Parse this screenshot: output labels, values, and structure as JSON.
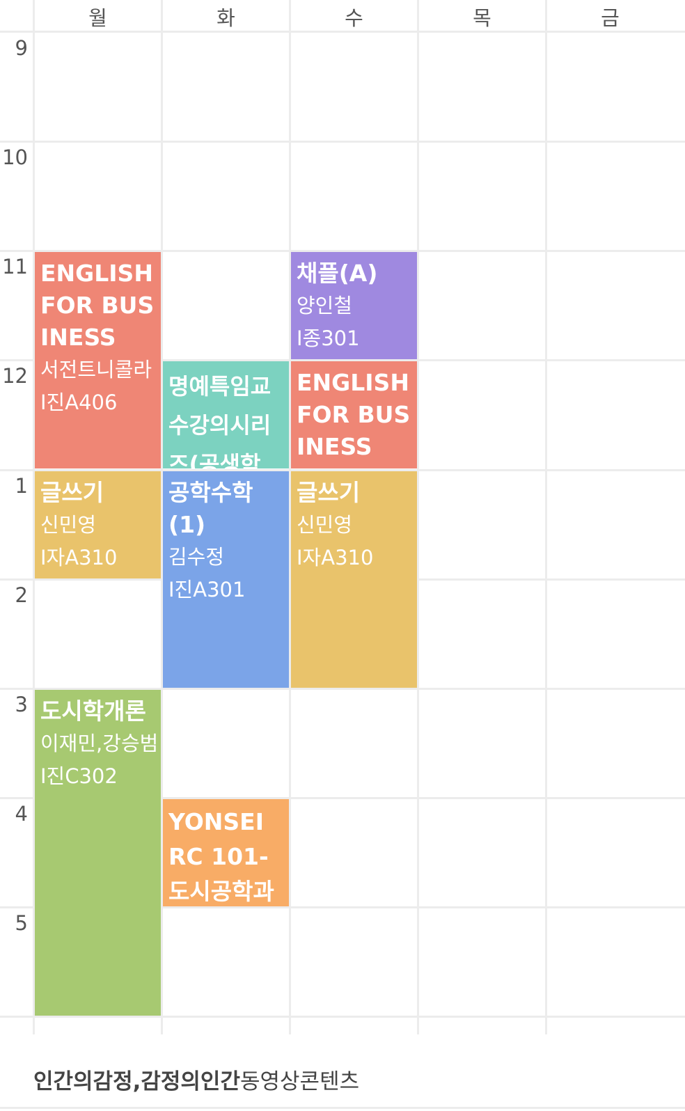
{
  "days": [
    "월",
    "화",
    "수",
    "목",
    "금"
  ],
  "hours": [
    "9",
    "10",
    "11",
    "12",
    "1",
    "2",
    "3",
    "4",
    "5"
  ],
  "courses": [
    {
      "id": "c1",
      "name": "ENGLISH FOR BUSINESS",
      "prof": "서전트니콜라",
      "room": "I진A406",
      "color": "#EF8675"
    },
    {
      "id": "c2",
      "name": "채플(A)",
      "prof": "양인철",
      "room": "I종301",
      "color": "#9F89E0"
    },
    {
      "id": "c3",
      "name": "명예특임교수강의시리즈(공생학",
      "color": "#7CD2C0"
    },
    {
      "id": "c4",
      "name": "ENGLISH FOR BUSINESS",
      "color": "#EF8675"
    },
    {
      "id": "c5",
      "name": "글쓰기",
      "prof": "신민영",
      "room": "I자A310",
      "color": "#E9C36B"
    },
    {
      "id": "c6",
      "name": "공학수학(1)",
      "prof": "김수정",
      "room": "I진A301",
      "color": "#7BA4E8"
    },
    {
      "id": "c7",
      "name": "글쓰기",
      "prof": "신민영",
      "room": "I자A310",
      "color": "#E9C36B"
    },
    {
      "id": "c8",
      "name": "도시학개론",
      "prof": "이재민,강승범",
      "room": "I진C302",
      "color": "#A7C971"
    },
    {
      "id": "c9",
      "name": "YONSEI RC 101-도시공학과",
      "color": "#F8AC66"
    }
  ],
  "footer": {
    "title_bold": "인간의감정,감정의인간",
    "title_normal": "동영상콘텐츠"
  }
}
